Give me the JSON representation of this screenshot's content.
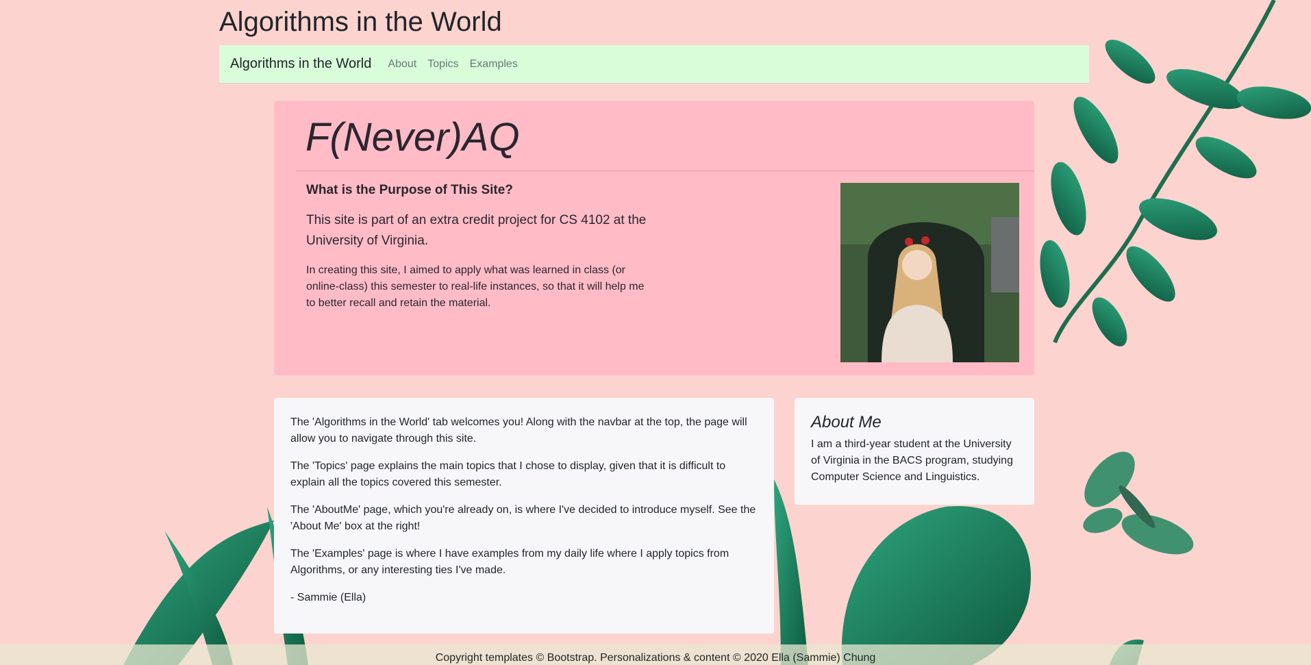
{
  "site": {
    "title": "Algorithms in the World"
  },
  "navbar": {
    "brand": "Algorithms in the World",
    "links": [
      "About",
      "Topics",
      "Examples"
    ]
  },
  "jumbotron": {
    "heading": "F(Never)AQ",
    "purpose_title": "What is the Purpose of This Site?",
    "lead": "This site is part of an extra credit project for CS 4102 at the University of Virginia.",
    "description": "In creating this site, I aimed to apply what was learned in class (or online-class) this semester to real-life instances, so that it will help me to better recall and retain the material."
  },
  "main_card": {
    "paragraphs": [
      "The 'Algorithms in the World' tab welcomes you! Along with the navbar at the top, the page will allow you to navigate through this site.",
      "The 'Topics' page explains the main topics that I chose to display, given that it is difficult to explain all the topics covered this semester.",
      "The 'AboutMe' page, which you're already on, is where I've decided to introduce myself. See the 'About Me' box at the right!",
      "The 'Examples' page is where I have examples from my daily life where I apply topics from Algorithms, or any interesting ties I've made.",
      "- Sammie (Ella)"
    ]
  },
  "about_card": {
    "title": "About Me",
    "text": "I am a third-year student at the University of Virginia in the BACS program, studying Computer Science and Linguistics."
  },
  "footer": {
    "text": "Copyright templates © Bootstrap. Personalizations & content © 2020 Ella (Sammie) Chung"
  },
  "colors": {
    "background": "#fdd3cf",
    "navbar": "#d8fdd8",
    "jumbotron": "#ffbcc6",
    "card": "#f7f7f9",
    "leaf_green": "#1f7a5a"
  }
}
